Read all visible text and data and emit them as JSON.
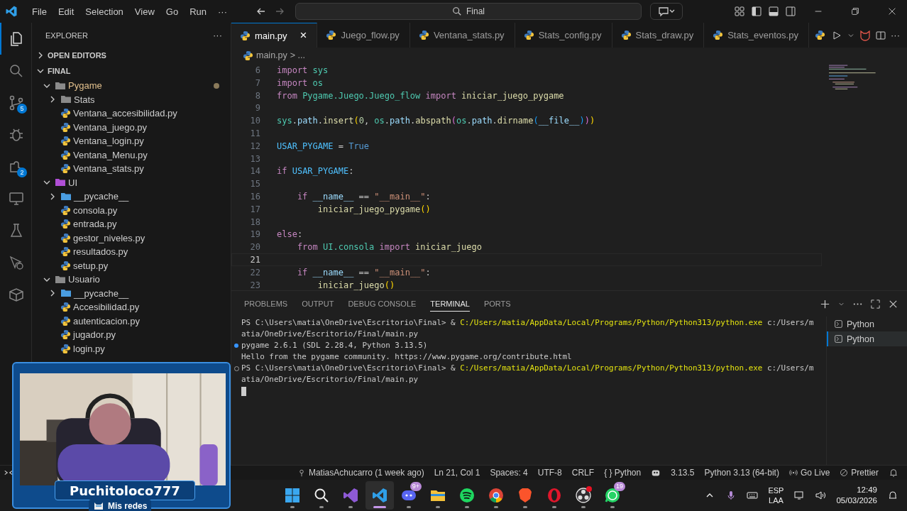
{
  "menu": [
    "File",
    "Edit",
    "Selection",
    "View",
    "Go",
    "Run",
    "···"
  ],
  "search": {
    "value": "Final"
  },
  "activity_bar": [
    {
      "kind": "explorer",
      "selected": true
    },
    {
      "kind": "search",
      "selected": false
    },
    {
      "kind": "source-control",
      "selected": false,
      "badge": "5"
    },
    {
      "kind": "debug",
      "selected": false
    },
    {
      "kind": "extensions",
      "selected": false,
      "badge": "2"
    },
    {
      "kind": "remote",
      "selected": false
    },
    {
      "kind": "testing",
      "selected": false
    },
    {
      "kind": "pointer",
      "selected": false
    },
    {
      "kind": "container",
      "selected": false
    }
  ],
  "explorer": {
    "title": "EXPLORER",
    "more": "···",
    "sections": [
      {
        "label": "OPEN EDITORS",
        "expanded": false
      },
      {
        "label": "FINAL",
        "expanded": true
      }
    ],
    "tree": [
      {
        "kind": "folder",
        "label": "Pygame",
        "expanded": true,
        "modified": true,
        "color": "#8a8a8a",
        "children": [
          {
            "kind": "folder",
            "label": "Stats",
            "expanded": false,
            "modified": false,
            "color": "#8a8a8a"
          },
          {
            "kind": "file",
            "label": "Ventana_accesibilidad.py"
          },
          {
            "kind": "file",
            "label": "Ventana_juego.py"
          },
          {
            "kind": "file",
            "label": "Ventana_login.py"
          },
          {
            "kind": "file",
            "label": "Ventana_Menu.py"
          },
          {
            "kind": "file",
            "label": "Ventana_stats.py"
          }
        ]
      },
      {
        "kind": "folder",
        "label": "UI",
        "expanded": true,
        "modified": false,
        "color": "#b04fd6",
        "children": [
          {
            "kind": "folder",
            "label": "__pycache__",
            "expanded": false,
            "modified": false,
            "color": "#4a9de0"
          },
          {
            "kind": "file",
            "label": "consola.py"
          },
          {
            "kind": "file",
            "label": "entrada.py"
          },
          {
            "kind": "file",
            "label": "gestor_niveles.py"
          },
          {
            "kind": "file",
            "label": "resultados.py"
          },
          {
            "kind": "file",
            "label": "setup.py"
          }
        ]
      },
      {
        "kind": "folder",
        "label": "Usuario",
        "expanded": true,
        "modified": false,
        "color": "#8a8a8a",
        "children": [
          {
            "kind": "folder",
            "label": "__pycache__",
            "expanded": false,
            "modified": false,
            "color": "#4a9de0"
          },
          {
            "kind": "file",
            "label": "Accesibilidad.py"
          },
          {
            "kind": "file",
            "label": "autenticacion.py"
          },
          {
            "kind": "file",
            "label": "jugador.py"
          },
          {
            "kind": "file",
            "label": "login.py"
          }
        ]
      }
    ]
  },
  "tabs": [
    {
      "label": "main.py",
      "selected": true,
      "close": "×"
    },
    {
      "label": "Juego_flow.py",
      "selected": false
    },
    {
      "label": "Ventana_stats.py",
      "selected": false
    },
    {
      "label": "Stats_config.py",
      "selected": false
    },
    {
      "label": "Stats_draw.py",
      "selected": false
    },
    {
      "label": "Stats_eventos.py",
      "selected": false
    }
  ],
  "breadcrumb": {
    "file": "main.py",
    "rest": "> ..."
  },
  "code": [
    {
      "n": "6",
      "current": false,
      "tokens": [
        {
          "kind": "kw",
          "text": "import"
        },
        {
          "kind": "mod",
          "text": " sys"
        }
      ]
    },
    {
      "n": "7",
      "current": false,
      "tokens": [
        {
          "kind": "kw",
          "text": "import"
        },
        {
          "kind": "mod",
          "text": " os"
        }
      ]
    },
    {
      "n": "8",
      "current": false,
      "tokens": [
        {
          "kind": "kw",
          "text": "from"
        },
        {
          "kind": "mod",
          "text": " Pygame.Juego.Juego_flow"
        },
        {
          "kind": "kw",
          "text": " import"
        },
        {
          "kind": "fn",
          "text": " iniciar_juego_pygame"
        }
      ]
    },
    {
      "n": "9",
      "current": false
    },
    {
      "n": "10",
      "current": false,
      "tokens": [
        {
          "kind": "mod",
          "text": "sys"
        },
        {
          "kind": "plain",
          "text": "."
        },
        {
          "kind": "var",
          "text": "path"
        },
        {
          "kind": "plain",
          "text": "."
        },
        {
          "kind": "fn",
          "text": "insert"
        },
        {
          "kind": "br1",
          "text": "("
        },
        {
          "kind": "num",
          "text": "0"
        },
        {
          "kind": "plain",
          "text": ","
        },
        {
          "kind": "mod",
          "text": " os"
        },
        {
          "kind": "plain",
          "text": "."
        },
        {
          "kind": "var",
          "text": "path"
        },
        {
          "kind": "plain",
          "text": "."
        },
        {
          "kind": "fn",
          "text": "abspath"
        },
        {
          "kind": "br2",
          "text": "("
        },
        {
          "kind": "mod",
          "text": "os"
        },
        {
          "kind": "plain",
          "text": "."
        },
        {
          "kind": "var",
          "text": "path"
        },
        {
          "kind": "plain",
          "text": "."
        },
        {
          "kind": "fn",
          "text": "dirname"
        },
        {
          "kind": "br3",
          "text": "("
        },
        {
          "kind": "var",
          "text": "__file__"
        },
        {
          "kind": "br3",
          "text": ")"
        },
        {
          "kind": "br2",
          "text": ")"
        },
        {
          "kind": "br1",
          "text": ")"
        }
      ]
    },
    {
      "n": "11",
      "current": false
    },
    {
      "n": "12",
      "current": false,
      "tokens": [
        {
          "kind": "const",
          "text": "USAR_PYGAME"
        },
        {
          "kind": "plain",
          "text": " ="
        },
        {
          "kind": "bool",
          "text": " True"
        }
      ]
    },
    {
      "n": "13",
      "current": false
    },
    {
      "n": "14",
      "current": false,
      "tokens": [
        {
          "kind": "kw",
          "text": "if"
        },
        {
          "kind": "const",
          "text": " USAR_PYGAME"
        },
        {
          "kind": "plain",
          "text": ":"
        }
      ]
    },
    {
      "n": "15",
      "current": false
    },
    {
      "n": "16",
      "current": false,
      "tokens": [
        {
          "kind": "kw",
          "text": "    if"
        },
        {
          "kind": "var",
          "text": " __name__"
        },
        {
          "kind": "plain",
          "text": " =="
        },
        {
          "kind": "str",
          "text": " \"__main__\""
        },
        {
          "kind": "plain",
          "text": ":"
        }
      ]
    },
    {
      "n": "17",
      "current": false,
      "tokens": [
        {
          "kind": "fn",
          "text": "        iniciar_juego_pygame"
        },
        {
          "kind": "br1",
          "text": "()"
        }
      ]
    },
    {
      "n": "18",
      "current": false
    },
    {
      "n": "19",
      "current": false,
      "tokens": [
        {
          "kind": "kw",
          "text": "else"
        },
        {
          "kind": "plain",
          "text": ":"
        }
      ]
    },
    {
      "n": "20",
      "current": false,
      "tokens": [
        {
          "kind": "kw",
          "text": "    from"
        },
        {
          "kind": "mod",
          "text": " UI.consola"
        },
        {
          "kind": "kw",
          "text": " import"
        },
        {
          "kind": "fn",
          "text": " iniciar_juego"
        }
      ]
    },
    {
      "n": "21",
      "current": true
    },
    {
      "n": "22",
      "current": false,
      "tokens": [
        {
          "kind": "kw",
          "text": "    if"
        },
        {
          "kind": "var",
          "text": " __name__"
        },
        {
          "kind": "plain",
          "text": " =="
        },
        {
          "kind": "str",
          "text": " \"__main__\""
        },
        {
          "kind": "plain",
          "text": ":"
        }
      ]
    },
    {
      "n": "23",
      "current": false,
      "tokens": [
        {
          "kind": "fn",
          "text": "        iniciar_juego"
        },
        {
          "kind": "br1",
          "text": "()"
        }
      ]
    }
  ],
  "panel_tabs": [
    {
      "label": "PROBLEMS",
      "selected": false
    },
    {
      "label": "OUTPUT",
      "selected": false
    },
    {
      "label": "DEBUG CONSOLE",
      "selected": false
    },
    {
      "label": "TERMINAL",
      "selected": true
    },
    {
      "label": "PORTS",
      "selected": false
    }
  ],
  "terminal": [
    {
      "kind": "plain",
      "segments": [
        {
          "kind": "plain",
          "text": "PS C:\\Users\\matia\\OneDrive\\Escritorio\\Final> &"
        },
        {
          "kind": "path",
          "text": " C:/Users/matia/AppData/Local/Programs/Python/Python313/python.exe"
        },
        {
          "kind": "plain",
          "text": " c:/Users/m"
        }
      ]
    },
    {
      "kind": "plain",
      "segments": [
        {
          "kind": "plain",
          "text": "atia/OneDrive/Escritorio/Final/main.py"
        }
      ]
    },
    {
      "kind": "success",
      "segments": [
        {
          "kind": "plain",
          "text": "pygame 2.6.1 (SDL 2.28.4, Python 3.13.5)"
        }
      ]
    },
    {
      "kind": "plain",
      "segments": [
        {
          "kind": "plain",
          "text": "Hello from the pygame community. https://www.pygame.org/contribute.html"
        }
      ]
    },
    {
      "kind": "command",
      "segments": [
        {
          "kind": "plain",
          "text": "PS C:\\Users\\matia\\OneDrive\\Escritorio\\Final> &"
        },
        {
          "kind": "path",
          "text": " C:/Users/matia/AppData/Local/Programs/Python/Python313/python.exe"
        },
        {
          "kind": "plain",
          "text": " c:/Users/m"
        }
      ]
    },
    {
      "kind": "plain",
      "segments": [
        {
          "kind": "plain",
          "text": "atia/OneDrive/Escritorio/Final/main.py"
        }
      ]
    }
  ],
  "terminals": [
    {
      "label": "Python",
      "selected": false
    },
    {
      "label": "Python",
      "selected": true
    }
  ],
  "status_bar": [
    {
      "kind": "author",
      "text": "MatiasAchucarro (1 week ago)"
    },
    {
      "kind": "plain",
      "text": "Ln 21, Col 1"
    },
    {
      "kind": "plain",
      "text": "Spaces: 4"
    },
    {
      "kind": "plain",
      "text": "UTF-8"
    },
    {
      "kind": "plain",
      "text": "CRLF"
    },
    {
      "kind": "language",
      "prefix": "{ }",
      "text": "Python"
    },
    {
      "kind": "copilot"
    },
    {
      "kind": "plain",
      "text": "3.13.5"
    },
    {
      "kind": "plain",
      "text": "Python 3.13 (64-bit)"
    },
    {
      "kind": "live",
      "text": "Go Live"
    },
    {
      "kind": "prettier",
      "text": "Prettier"
    },
    {
      "kind": "bell"
    }
  ],
  "stream_overlay": {
    "name": "Puchitoloco777",
    "link": "Mis redes"
  },
  "taskbar": {
    "apps": [
      {
        "kind": "start",
        "active": false
      },
      {
        "kind": "search",
        "active": false
      },
      {
        "kind": "visual-studio",
        "active": false
      },
      {
        "kind": "vscode",
        "active": true
      },
      {
        "kind": "discord",
        "active": false,
        "badge": "9+"
      },
      {
        "kind": "files",
        "active": false
      },
      {
        "kind": "spotify",
        "active": false
      },
      {
        "kind": "chrome",
        "active": false
      },
      {
        "kind": "brave",
        "active": false
      },
      {
        "kind": "opera",
        "active": false
      },
      {
        "kind": "obs",
        "active": false,
        "dot": true
      },
      {
        "kind": "whatsapp",
        "active": false,
        "badge": "19"
      }
    ],
    "language": [
      "ESP",
      "LAA"
    ],
    "time": "12:49",
    "date": "05/03/2026"
  }
}
